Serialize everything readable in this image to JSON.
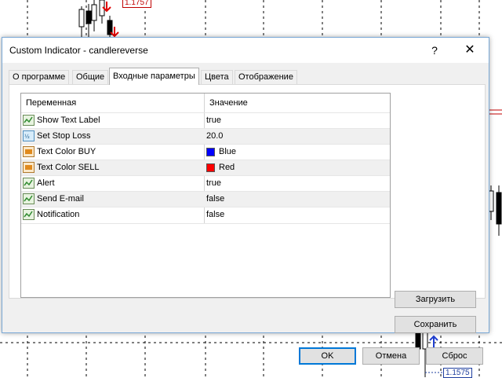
{
  "chart": {
    "price_top": "1.1757",
    "price_bottom": "1.1575"
  },
  "dialog": {
    "title": "Custom Indicator - candlereverse",
    "help_glyph": "?",
    "close_glyph": "✕",
    "tabs": [
      {
        "label": "О программе",
        "active": false
      },
      {
        "label": "Общие",
        "active": false
      },
      {
        "label": "Входные параметры",
        "active": true
      },
      {
        "label": "Цвета",
        "active": false
      },
      {
        "label": "Отображение",
        "active": false
      }
    ],
    "table": {
      "header_variable": "Переменная",
      "header_value": "Значение",
      "rows": [
        {
          "name": "Show Text Label",
          "value": "true",
          "icon": "bool-param-icon"
        },
        {
          "name": "Set Stop Loss",
          "value": "20.0",
          "icon": "double-param-icon"
        },
        {
          "name": "Text Color BUY",
          "value": "Blue",
          "icon": "color-param-icon",
          "swatch": "#0000ff"
        },
        {
          "name": "Text Color SELL",
          "value": "Red",
          "icon": "color-param-icon",
          "swatch": "#ff0000"
        },
        {
          "name": "Alert",
          "value": "true",
          "icon": "bool-param-icon"
        },
        {
          "name": "Send E-mail",
          "value": "false",
          "icon": "bool-param-icon"
        },
        {
          "name": "Notification",
          "value": "false",
          "icon": "bool-param-icon"
        }
      ]
    },
    "buttons": {
      "load": "Загрузить",
      "save": "Сохранить",
      "ok": "OK",
      "cancel": "Отмена",
      "reset": "Сброс"
    }
  }
}
